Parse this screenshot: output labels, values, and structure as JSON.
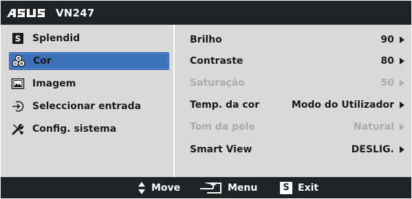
{
  "header": {
    "brand": "ASUS",
    "model": "VN247"
  },
  "sidebar": {
    "items": [
      {
        "label": "Splendid",
        "icon": "splendid-s-icon",
        "selected": false
      },
      {
        "label": "Cor",
        "icon": "color-circles-icon",
        "selected": true
      },
      {
        "label": "Imagem",
        "icon": "image-icon",
        "selected": false
      },
      {
        "label": "Seleccionar entrada",
        "icon": "input-select-icon",
        "selected": false
      },
      {
        "label": "Config. sistema",
        "icon": "tools-icon",
        "selected": false
      }
    ]
  },
  "panel": {
    "rows": [
      {
        "label": "Brilho",
        "value": "90",
        "enabled": true
      },
      {
        "label": "Contraste",
        "value": "80",
        "enabled": true
      },
      {
        "label": "Saturação",
        "value": "50",
        "enabled": false
      },
      {
        "label": "Temp. da cor",
        "value": "Modo do Utilizador",
        "enabled": true
      },
      {
        "label": "Tom da pele",
        "value": "Natural",
        "enabled": false
      },
      {
        "label": "Smart View",
        "value": "DESLIG.",
        "enabled": true
      }
    ]
  },
  "footer": {
    "move_label": "Move",
    "menu_label": "Menu",
    "exit_key": "S",
    "exit_label": "Exit"
  },
  "colors": {
    "bar_bg": "#1e2326",
    "panel_bg": "#d9d9d9",
    "selected_bg": "#3c72b9",
    "disabled_text": "#ababab"
  }
}
